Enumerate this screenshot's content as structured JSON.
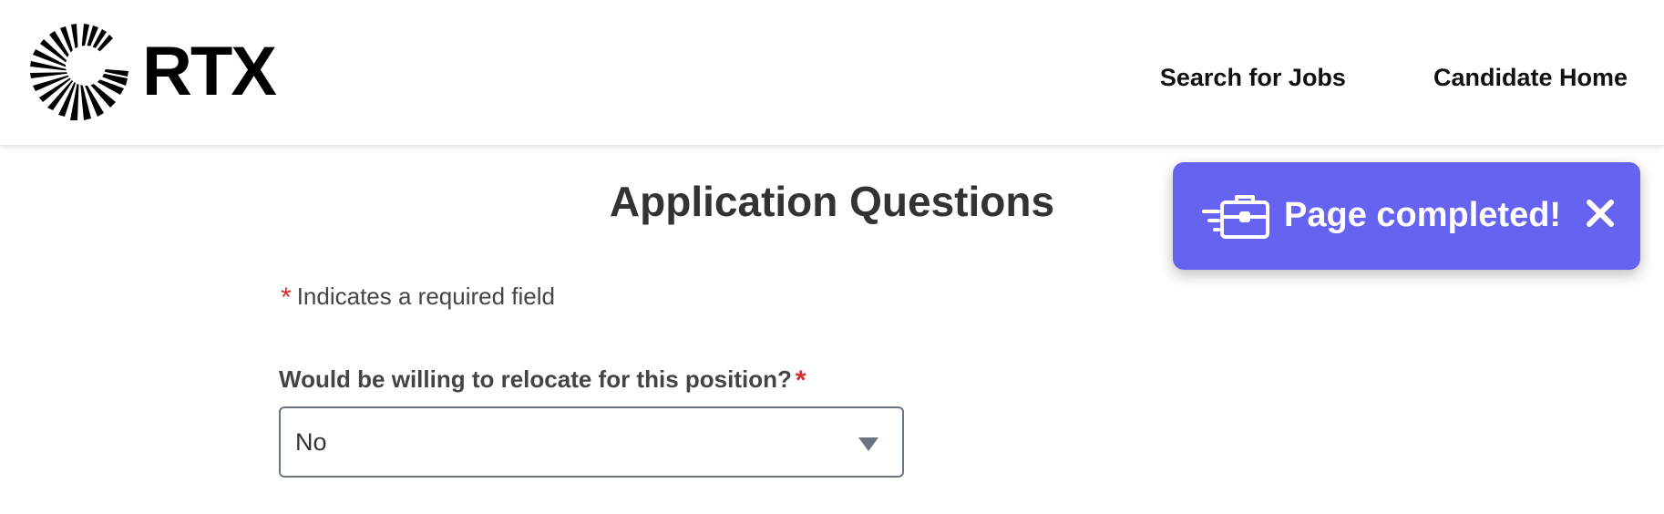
{
  "brand": {
    "name": "RTX",
    "logo_icon": "sunburst-icon"
  },
  "nav": {
    "search_jobs": "Search for Jobs",
    "candidate_home": "Candidate Home"
  },
  "page": {
    "title": "Application Questions",
    "required_marker": "*",
    "required_note": "Indicates a required field"
  },
  "question": {
    "label": "Would be willing to relocate for this position?",
    "required_marker": "*",
    "selected_value": "No",
    "icon": "chevron-down-icon"
  },
  "toast": {
    "message": "Page completed!",
    "icon": "briefcase-speed-icon",
    "close_icon": "close-icon"
  },
  "colors": {
    "toast_bg": "#6563f0",
    "required": "#d32f2f",
    "text": "#333333"
  }
}
